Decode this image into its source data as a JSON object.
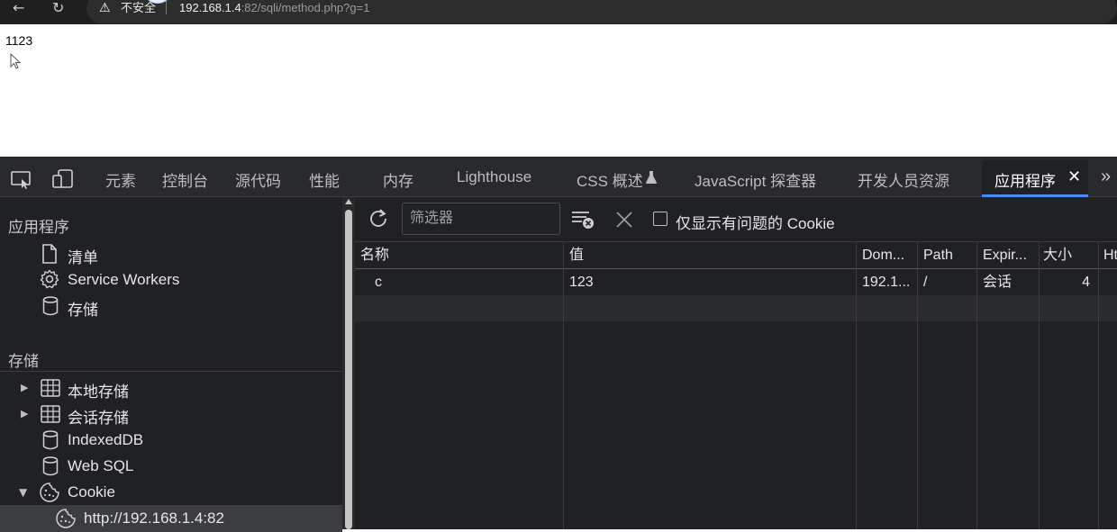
{
  "browser": {
    "security_label": "不安全",
    "url_host": "192.168.1.4",
    "url_rest": ":82/sqli/method.php?g=1"
  },
  "page": {
    "output_text": "1123"
  },
  "devtools": {
    "tabs": [
      "元素",
      "控制台",
      "源代码",
      "性能",
      "内存",
      "Lighthouse",
      "CSS 概述",
      "JavaScript 探查器",
      "开发人员资源",
      "应用程序"
    ],
    "active_tab": "应用程序",
    "sidebar": {
      "app_header": "应用程序",
      "app_items": [
        "清单",
        "Service Workers",
        "存储"
      ],
      "storage_header": "存储",
      "storage_items": [
        "本地存储",
        "会话存储",
        "IndexedDB",
        "Web SQL",
        "Cookie"
      ],
      "cookie_origin": "http://192.168.1.4:82"
    },
    "toolbar": {
      "filter_placeholder": "筛选器",
      "only_issues_label": "仅显示有问题的 Cookie",
      "only_issues_checked": false
    },
    "cookie_table": {
      "columns": [
        "名称",
        "值",
        "Dom...",
        "Path",
        "Expir...",
        "大小",
        "Ht"
      ],
      "rows": [
        {
          "name": "c",
          "value": "123",
          "domain": "192.1...",
          "path": "/",
          "expires": "会话",
          "size": "4"
        }
      ]
    }
  },
  "colors": {
    "devtools_bg": "#202124",
    "accent": "#4a8af4"
  }
}
